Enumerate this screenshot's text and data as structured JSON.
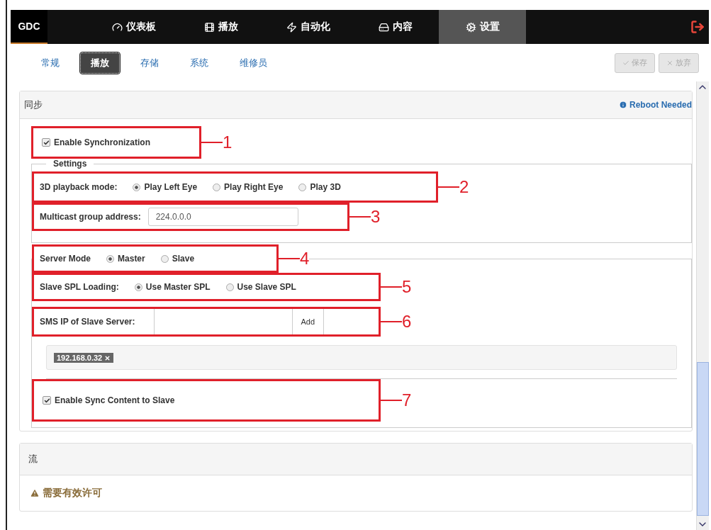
{
  "nav": {
    "logo": "GDC",
    "items": [
      {
        "label": "仪表板",
        "selected": false
      },
      {
        "label": "播放",
        "selected": false
      },
      {
        "label": "自动化",
        "selected": false
      },
      {
        "label": "内容",
        "selected": false
      },
      {
        "label": "设置",
        "selected": true
      }
    ]
  },
  "subtabs": [
    {
      "label": "常规",
      "selected": false
    },
    {
      "label": "播放",
      "selected": true
    },
    {
      "label": "存储",
      "selected": false
    },
    {
      "label": "系统",
      "selected": false
    },
    {
      "label": "维修员",
      "selected": false
    }
  ],
  "actions": [
    {
      "label": "保存",
      "disabled": true
    },
    {
      "label": "放弃",
      "disabled": true
    }
  ],
  "sync_panel": {
    "title": "同步",
    "notice": "Reboot Needed",
    "enable_sync": {
      "label": "Enable Synchronization",
      "checked": true,
      "annotation": "1"
    },
    "settings": {
      "legend": "Settings",
      "playback_mode": {
        "label": "3D playback mode:",
        "annotation": "2",
        "options": [
          {
            "label": "Play Left Eye",
            "selected": true
          },
          {
            "label": "Play Right Eye",
            "selected": false
          },
          {
            "label": "Play 3D",
            "selected": false
          }
        ]
      },
      "multicast": {
        "label": "Multicast group address:",
        "value": "224.0.0.0",
        "annotation": "3"
      }
    },
    "server_mode": {
      "legend": "Server Mode",
      "annotation": "4",
      "options": [
        {
          "label": "Master",
          "selected": true
        },
        {
          "label": "Slave",
          "selected": false
        }
      ],
      "spl_loading": {
        "label": "Slave SPL Loading:",
        "annotation": "5",
        "options": [
          {
            "label": "Use Master SPL",
            "selected": true
          },
          {
            "label": "Use Slave SPL",
            "selected": false
          }
        ]
      },
      "slave_ip": {
        "label": "SMS IP of Slave Server:",
        "button": "Add",
        "annotation": "6"
      },
      "tags": [
        "192.168.0.32"
      ],
      "sync_content": {
        "label": "Enable Sync Content to Slave",
        "checked": true,
        "annotation": "7"
      }
    }
  },
  "stream_panel": {
    "title": "流",
    "warning": "需要有效许可"
  }
}
